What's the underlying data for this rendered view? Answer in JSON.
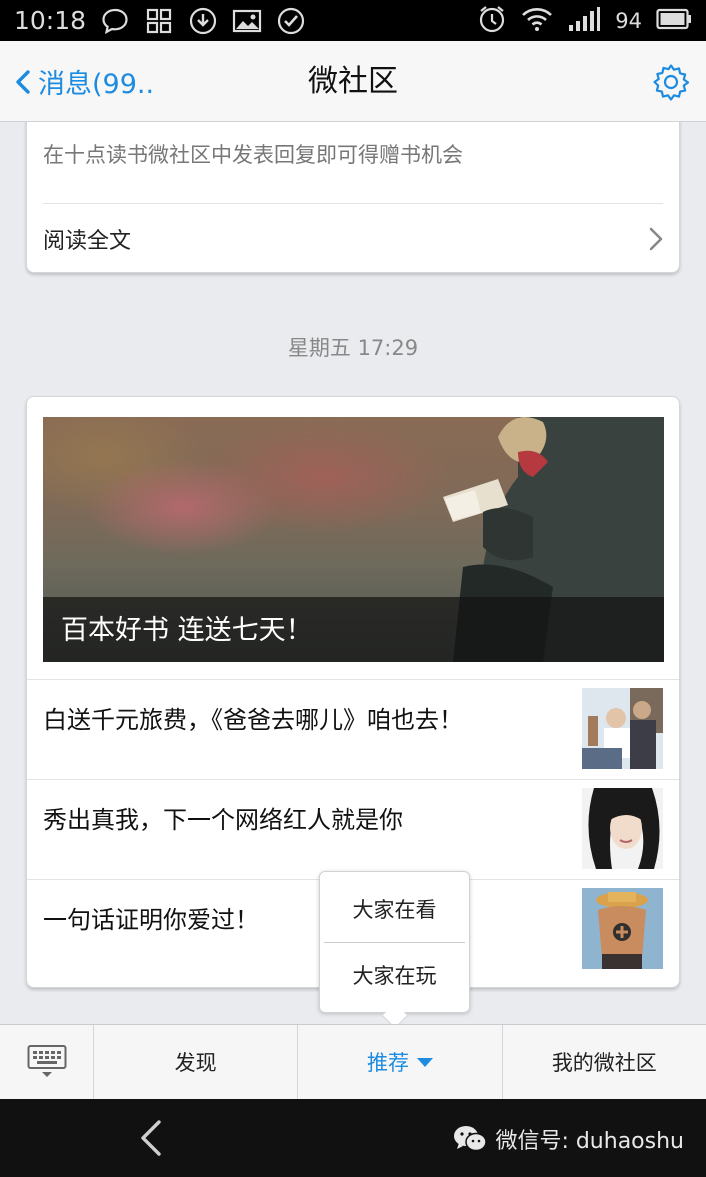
{
  "status_bar": {
    "time": "10:18",
    "battery": "94"
  },
  "header": {
    "back_label": "消息(99..",
    "title": "微社区"
  },
  "top_card": {
    "description": "在十点读书微社区中发表回复即可得赠书机会",
    "read_full": "阅读全文"
  },
  "timestamp": "星期五 17:29",
  "main_card": {
    "hero_caption": "百本好书 连送七天！",
    "items": [
      {
        "title": "白送千元旅费，《爸爸去哪儿》咱也去！"
      },
      {
        "title": "秀出真我，下一个网络红人就是你"
      },
      {
        "title": "一句话证明你爱过！"
      }
    ]
  },
  "popup_menu": {
    "options": [
      "大家在看",
      "大家在玩"
    ]
  },
  "bottom_menu": {
    "items": [
      "发现",
      "推荐",
      "我的微社区"
    ],
    "active_index": 1
  },
  "watermark": {
    "text": "微信号: duhaoshu"
  },
  "colors": {
    "accent": "#1d8ce0",
    "background": "#e9ebee",
    "status_bar": "#000000",
    "nav_bar": "#111111"
  }
}
